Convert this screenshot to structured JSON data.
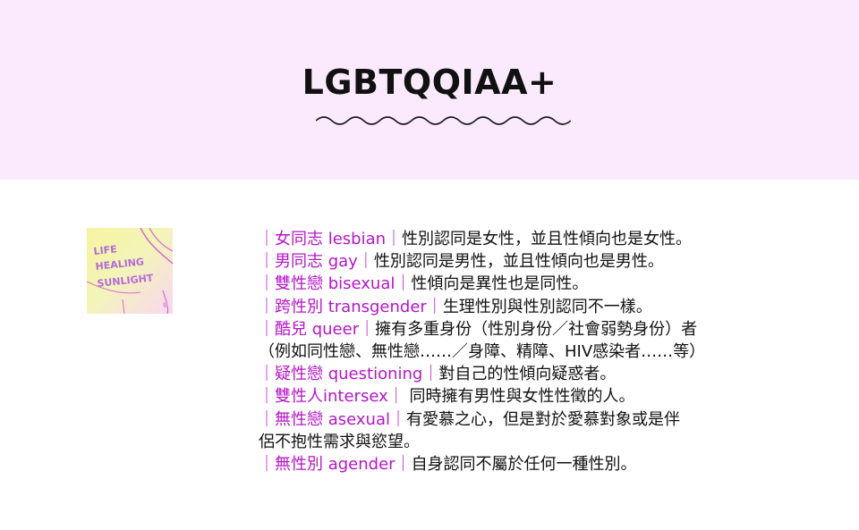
{
  "header": {
    "title": "LGBTQQIAA+",
    "bg_color": "#fbeafd"
  },
  "thumbnail": {
    "icon": "artwork-thumbnail",
    "text": "LIFE HEALING SUNLIGHT"
  },
  "accent_color": "#b516c7",
  "definitions": [
    {
      "term": "｜女同志 lesbian｜",
      "desc": "性別認同是女性，並且性傾向也是女性。"
    },
    {
      "term": "｜男同志 gay｜",
      "desc": "性別認同是男性，並且性傾向也是男性。"
    },
    {
      "term": "｜雙性戀 bisexual｜",
      "desc": "性傾向是異性也是同性。"
    },
    {
      "term": "｜跨性別 transgender｜",
      "desc": "生理性別與性別認同不一樣。"
    },
    {
      "term": "｜酷兒 queer｜",
      "desc": "擁有多重身份（性別身份／社會弱勢身份）者",
      "cont": "（例如同性戀、無性戀……／身障、精障、HIV感染者……等）"
    },
    {
      "term": "｜疑性戀 questioning｜",
      "desc": "對自己的性傾向疑惑者。"
    },
    {
      "term": "｜雙性人intersex｜",
      "desc": " 同時擁有男性與女性性徵的人。"
    },
    {
      "term": "｜無性戀 asexual｜",
      "desc": "有愛慕之心，但是對於愛慕對象或是伴",
      "cont": "侶不抱性需求與慾望。"
    },
    {
      "term": "｜無性別 agender｜",
      "desc": "自身認同不屬於任何一種性別。"
    }
  ]
}
